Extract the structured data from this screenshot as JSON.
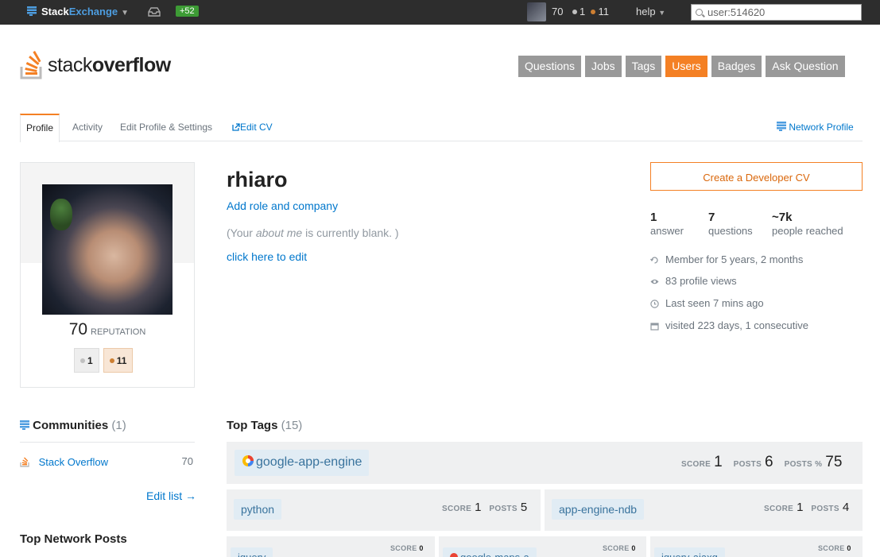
{
  "topbar": {
    "brand_a": "Stack",
    "brand_b": "Exchange",
    "rep_change": "+52",
    "rep": "70",
    "silver": "1",
    "bronze": "11",
    "help": "help",
    "search_value": "user:514620"
  },
  "header": {
    "logo_text_a": "stack",
    "logo_text_b": "overflow",
    "nav": [
      "Questions",
      "Jobs",
      "Tags",
      "Users",
      "Badges",
      "Ask Question"
    ],
    "active_nav": "Users"
  },
  "tabs": {
    "profile": "Profile",
    "activity": "Activity",
    "edit": "Edit Profile & Settings",
    "edit_cv": "Edit CV",
    "network": "Network Profile"
  },
  "card": {
    "reputation": "70",
    "reputation_label": "REPUTATION",
    "silver": "1",
    "bronze": "11"
  },
  "profile": {
    "username": "rhiaro",
    "role_link": "Add role and company",
    "about_pre": "(Your ",
    "about_em": "about me",
    "about_post": " is currently blank. )",
    "edit_link": "click here to edit"
  },
  "right": {
    "cv_button": "Create a Developer CV",
    "stats": [
      {
        "n": "1",
        "l": "answer"
      },
      {
        "n": "7",
        "l": "questions"
      },
      {
        "n": "~7k",
        "l": "people reached"
      }
    ],
    "info": [
      {
        "icon": "history-icon",
        "text": "Member for 5 years, 2 months"
      },
      {
        "icon": "eye-icon",
        "text": "83 profile views"
      },
      {
        "icon": "clock-icon",
        "text": "Last seen 7 mins ago"
      },
      {
        "icon": "calendar-icon",
        "text": "visited 223 days, 1 consecutive"
      }
    ]
  },
  "communities": {
    "title": "Communities",
    "count": "(1)",
    "items": [
      {
        "name": "Stack Overflow",
        "rep": "70"
      }
    ],
    "edit_list": "Edit list →"
  },
  "top_network_posts": "Top Network Posts",
  "top_tags": {
    "title": "Top Tags",
    "count": "(15)",
    "main": {
      "tag": "google-app-engine",
      "score": "1",
      "posts": "6",
      "posts_pct": "75"
    },
    "row2": [
      {
        "tag": "python",
        "score": "1",
        "posts": "5"
      },
      {
        "tag": "app-engine-ndb",
        "score": "1",
        "posts": "4"
      }
    ],
    "row3": [
      {
        "tag": "jquery",
        "score": "0"
      },
      {
        "tag": "google-maps-a",
        "score": "0"
      },
      {
        "tag": "jquery-ajaxq",
        "score": "0"
      }
    ],
    "labels": {
      "score": "SCORE",
      "posts": "POSTS",
      "posts_pct": "POSTS %"
    }
  },
  "colors": {
    "accent": "#f48024",
    "link": "#0077cc",
    "topbar": "#2d2d2d",
    "tag_bg": "#e1ecf4",
    "tag_fg": "#39739d"
  }
}
